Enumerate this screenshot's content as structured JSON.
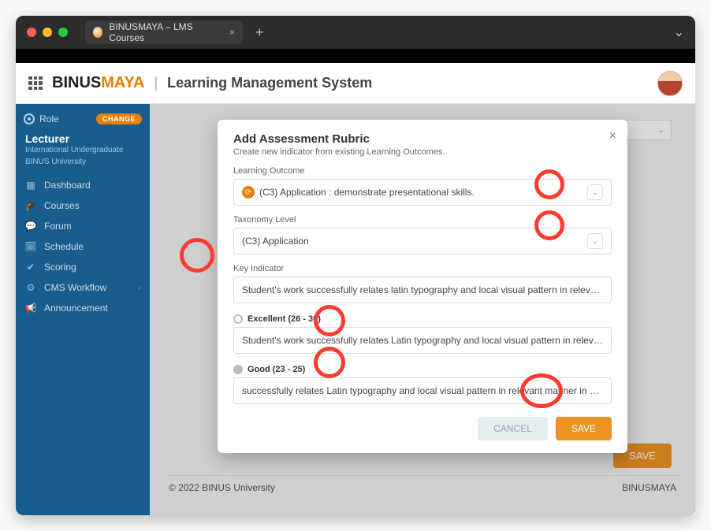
{
  "browser": {
    "tab_title": "BINUSMAYA – LMS Courses",
    "tab_close": "×",
    "new_tab": "+",
    "window_chevron": "⌄"
  },
  "header": {
    "logo_prefix": "BINUS",
    "logo_suffix": "MAYA",
    "divider": "|",
    "title": "Learning Management System"
  },
  "sidebar": {
    "role_label": "Role",
    "change_label": "CHANGE",
    "role_name": "Lecturer",
    "role_sub1": "International Undergraduate",
    "role_sub2": "BINUS University",
    "items": [
      {
        "icon": "▦",
        "label": "Dashboard"
      },
      {
        "icon": "🎓",
        "label": "Courses"
      },
      {
        "icon": "💬",
        "label": "Forum"
      },
      {
        "icon": "🗓",
        "label": "Schedule"
      },
      {
        "icon": "✔",
        "label": "Scoring"
      },
      {
        "icon": "⚙",
        "label": "CMS Workflow",
        "has_caret": true
      },
      {
        "icon": "📢",
        "label": "Announcement"
      }
    ]
  },
  "modal": {
    "title": "Add Assessment Rubric",
    "subtitle": "Create new indicator from existing Learning Outcomes.",
    "close": "×",
    "learning_outcome_label": "Learning Outcome",
    "learning_outcome_value": "(C3) Application : demonstrate presentational skills.",
    "taxonomy_label": "Taxonomy Level",
    "taxonomy_value": "(C3) Application",
    "key_indicator_label": "Key Indicator",
    "key_indicator_value": "Student's work successfully relates latin typography and local visual pattern in relevant manner",
    "levels": [
      {
        "label": "Excellent (26 - 30)",
        "filled": false,
        "text": "Student's work successfully relates Latin typography and local visual pattern in relevant manner in a highly"
      },
      {
        "label": "Good (23 - 25)",
        "filled": true,
        "text": "successfully relates Latin typography and local visual pattern in relevant manner in a quite relevant manner"
      }
    ],
    "cancel": "CANCEL",
    "save": "SAVE"
  },
  "page": {
    "save_button": "SAVE",
    "bg_dropdown_chevron": "⌄"
  },
  "footer": {
    "copyright": "© 2022 BINUS University",
    "brand": "BINUSMAYA"
  }
}
